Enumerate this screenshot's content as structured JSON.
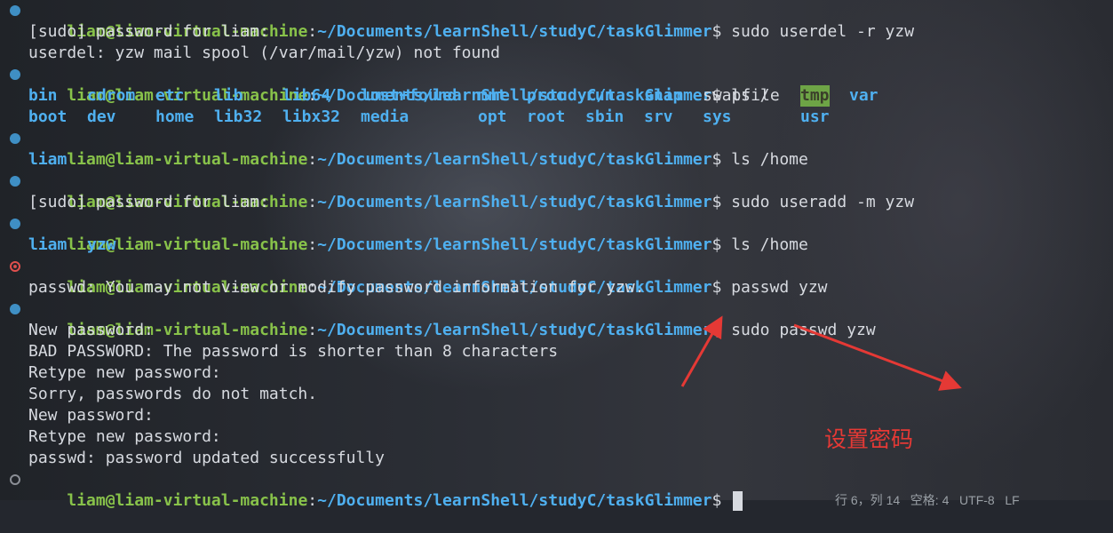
{
  "prompt": {
    "user": "liam@liam-virtual-machine",
    "colon": ":",
    "path": "~/Documents/learnShell/studyC/taskGlimmer",
    "dollar": "$"
  },
  "lines": {
    "l1_cmd": " sudo userdel -r yzw",
    "l2": "[sudo] password for liam:",
    "l3": "userdel: yzw mail spool (/var/mail/yzw) not found",
    "l4_cmd": " ls /",
    "l7_cmd": " ls /home",
    "l8": "liam",
    "l9_cmd": " sudo useradd -m yzw",
    "l10": "[sudo] password for liam:",
    "l11_cmd": " ls /home",
    "l12a": "liam",
    "l12b": "yzw",
    "l13_cmd": " passwd yzw",
    "l14": "passwd: You may not view or modify password information for yzw.",
    "l15_cmd": " sudo passwd yzw",
    "l16": "New password:",
    "l17": "BAD PASSWORD: The password is shorter than 8 characters",
    "l18": "Retype new password:",
    "l19": "Sorry, passwords do not match.",
    "l20": "New password:",
    "l21": "Retype new password:",
    "l22": "passwd: password updated successfully"
  },
  "ls_root": {
    "row1": [
      "bin",
      "cdrom",
      "etc",
      "lib",
      "lib64",
      "lost+found",
      "mnt",
      "proc",
      "run",
      "snap",
      "swapfile",
      "tmp",
      "var"
    ],
    "row2": [
      "boot",
      "dev",
      "home",
      "lib32",
      "libx32",
      "media",
      "opt",
      "root",
      "sbin",
      "srv",
      "sys",
      "usr"
    ]
  },
  "annotation": {
    "text": "设置密码",
    "color": "#e53935"
  },
  "status_bar": {
    "text": "行 6，列 14   空格: 4   UTF-8   LF"
  },
  "colors": {
    "user": "#88c24a",
    "path": "#4fb0f0",
    "text": "#d7dae0",
    "dot_ok": "#3f8fc4",
    "dot_error": "#e0504e"
  }
}
